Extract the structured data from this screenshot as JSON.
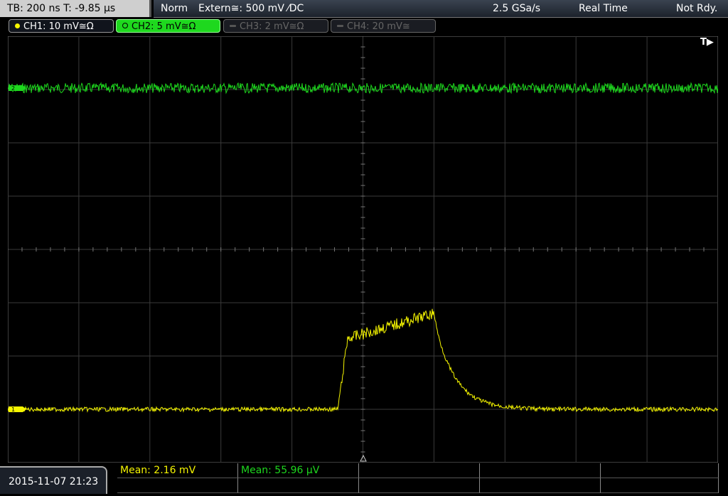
{
  "status": {
    "tb_label": "TB: 200 ns   T: -9.85 µs",
    "mode": "Norm",
    "trigger": "Extern≅: 500 mV ⁄DC",
    "sample_rate": "2.5 GSa/s",
    "acq_mode": "Real Time",
    "state": "Not Rdy."
  },
  "channels": [
    {
      "label": "CH1: 10 mV≅Ω",
      "color": "#f5f500"
    },
    {
      "label": "CH2: 5 mV≅Ω",
      "color": "#1ed81e"
    },
    {
      "label": "CH3: 2 mV≅Ω",
      "color": "#666666"
    },
    {
      "label": "CH4: 20 mV≅",
      "color": "#666666"
    }
  ],
  "trigger_marker": "T▶",
  "marker_ch1": "1",
  "marker_ch2": "2",
  "date": "2015-11-07 21:23",
  "measurements": {
    "ch1_mean": "Mean: 2.16 mV",
    "ch2_mean": "Mean: 55.96 µV"
  },
  "colors": {
    "ch1": "#f5f500",
    "ch2": "#1ed81e",
    "grid": "#3a3a3a"
  }
}
